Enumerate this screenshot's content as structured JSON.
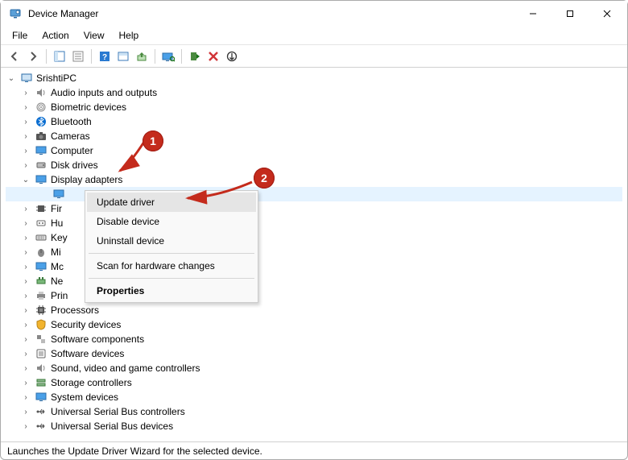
{
  "window": {
    "title": "Device Manager"
  },
  "menu": {
    "file": "File",
    "action": "Action",
    "view": "View",
    "help": "Help"
  },
  "tree": {
    "root": "SrishtiPC",
    "audio": "Audio inputs and outputs",
    "biometric": "Biometric devices",
    "bluetooth": "Bluetooth",
    "cameras": "Cameras",
    "computer": "Computer",
    "disk": "Disk drives",
    "display": "Display adapters",
    "display_child_partial": "",
    "firmware_partial": "Fir",
    "hid_partial": "Hu",
    "keyboards_partial": "Key",
    "mice_partial": "Mi",
    "monitors_partial": "Mc",
    "network_partial": "Ne",
    "print_partial": "Prin",
    "processors": "Processors",
    "security": "Security devices",
    "swcomp": "Software components",
    "swdev": "Software devices",
    "sound": "Sound, video and game controllers",
    "storage": "Storage controllers",
    "system": "System devices",
    "usbctrl": "Universal Serial Bus controllers",
    "usbdev": "Universal Serial Bus devices"
  },
  "context_menu": {
    "update": "Update driver",
    "disable": "Disable device",
    "uninstall": "Uninstall device",
    "scan": "Scan for hardware changes",
    "properties": "Properties"
  },
  "annotations": {
    "badge1": "1",
    "badge2": "2"
  },
  "status": {
    "text": "Launches the Update Driver Wizard for the selected device."
  }
}
